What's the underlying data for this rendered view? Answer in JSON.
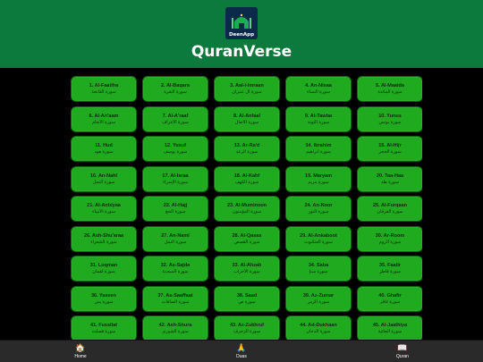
{
  "header": {
    "logo_text": "DeenApp",
    "title": "QuranVerse",
    "background": "#0c7a3c"
  },
  "colors": {
    "card_bg": "#1faa1f",
    "card_border": "#0a6a0a",
    "page_bg": "#000000"
  },
  "surahs": [
    {
      "en": "1. Al-Faatiha",
      "ar": "سورة الفاتحة"
    },
    {
      "en": "2. Al-Baqara",
      "ar": "سورة البقرة"
    },
    {
      "en": "3. Aal-i-Imraan",
      "ar": "سورة آل عمران"
    },
    {
      "en": "4. An-Nisaa",
      "ar": "سورة النساء"
    },
    {
      "en": "5. Al-Maaida",
      "ar": "سورة المائدة"
    },
    {
      "en": "6. Al-An'aam",
      "ar": "سورة الأنعام"
    },
    {
      "en": "7. Al-A'raaf",
      "ar": "سورة الأعراف"
    },
    {
      "en": "8. Al-Anfaal",
      "ar": "سورة الأنفال"
    },
    {
      "en": "9. At-Tawba",
      "ar": "سورة التوبة"
    },
    {
      "en": "10. Yunus",
      "ar": "سورة يونس"
    },
    {
      "en": "11. Hud",
      "ar": "سورة هود"
    },
    {
      "en": "12. Yusuf",
      "ar": "سورة يوسف"
    },
    {
      "en": "13. Ar-Ra'd",
      "ar": "سورة الرعد"
    },
    {
      "en": "14. Ibrahim",
      "ar": "سورة ابراهيم"
    },
    {
      "en": "15. Al-Hijr",
      "ar": "سورة الحجر"
    },
    {
      "en": "16. An-Nahl",
      "ar": "سورة النحل"
    },
    {
      "en": "17. Al-Israa",
      "ar": "سورة الإسراء"
    },
    {
      "en": "18. Al-Kahf",
      "ar": "سورة الكهف"
    },
    {
      "en": "19. Maryam",
      "ar": "سورة مريم"
    },
    {
      "en": "20. Taa-Haa",
      "ar": "سورة طه"
    },
    {
      "en": "21. Al-Anbiyaa",
      "ar": "سورة الأنبياء"
    },
    {
      "en": "22. Al-Hajj",
      "ar": "سورة الحج"
    },
    {
      "en": "23. Al-Muminoon",
      "ar": "سورة المؤمنون"
    },
    {
      "en": "24. An-Noor",
      "ar": "سورة النور"
    },
    {
      "en": "25. Al-Furqaan",
      "ar": "سورة الفرقان"
    },
    {
      "en": "26. Ash-Shu'araa",
      "ar": "سورة الشعراء"
    },
    {
      "en": "27. An-Naml",
      "ar": "سورة النمل"
    },
    {
      "en": "28. Al-Qasas",
      "ar": "سورة القصص"
    },
    {
      "en": "29. Al-Ankaboot",
      "ar": "سورة العنكبوت"
    },
    {
      "en": "30. Ar-Room",
      "ar": "سورة الروم"
    },
    {
      "en": "31. Luqman",
      "ar": "سورة لقمان"
    },
    {
      "en": "32. As-Sajda",
      "ar": "سورة السجدة"
    },
    {
      "en": "33. Al-Ahzab",
      "ar": "سورة الأحزاب"
    },
    {
      "en": "34. Saba",
      "ar": "سورة سبإ"
    },
    {
      "en": "35. Faatir",
      "ar": "سورة فاطر"
    },
    {
      "en": "36. Yaseen",
      "ar": "سورة يس"
    },
    {
      "en": "37. As-Saaffaat",
      "ar": "سورة الصافات"
    },
    {
      "en": "38. Saad",
      "ar": "سورة ص"
    },
    {
      "en": "39. Az-Zumar",
      "ar": "سورة الزمر"
    },
    {
      "en": "40. Ghafir",
      "ar": "سورة غافر"
    },
    {
      "en": "41. Fussilat",
      "ar": "سورة فصلت"
    },
    {
      "en": "42. Ash-Shura",
      "ar": "سورة الشورى"
    },
    {
      "en": "43. Az-Zukhruf",
      "ar": "سورة الزخرف"
    },
    {
      "en": "44. Ad-Dukhaan",
      "ar": "سورة الدخان"
    },
    {
      "en": "45. Al-Jaathiya",
      "ar": "سورة الجاثية"
    }
  ],
  "bottom_nav": [
    {
      "label": "Home",
      "icon": "home-icon",
      "glyph": "🏠"
    },
    {
      "label": "Duas",
      "icon": "praying-hands-icon",
      "glyph": "🙏"
    },
    {
      "label": "Quran",
      "icon": "book-icon",
      "glyph": "📖"
    }
  ]
}
